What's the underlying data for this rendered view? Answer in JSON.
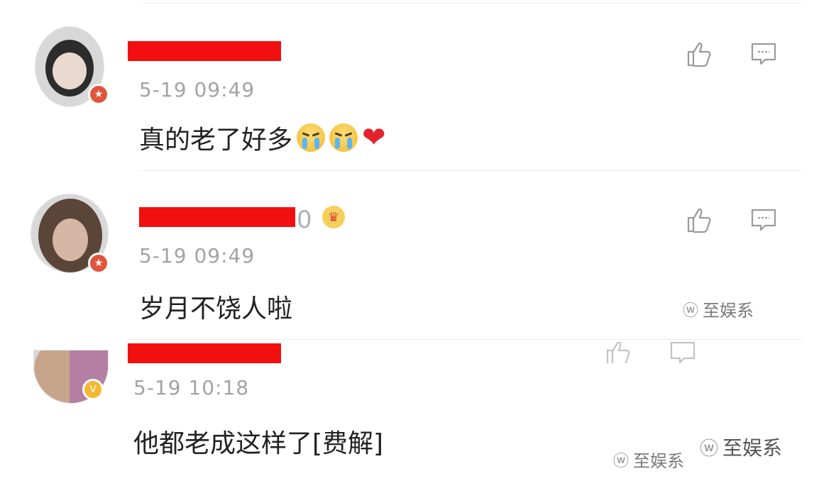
{
  "comments": [
    {
      "time": "5-19 09:49",
      "text": "真的老了好多",
      "emojis": [
        "crying-face",
        "crying-face",
        "red-heart"
      ],
      "badge_icon": "weibo-vip-icon",
      "accent": "#e0553c"
    },
    {
      "time": "5-19 09:49",
      "text": "岁月不饶人啦",
      "name_suffix": "0",
      "badge_icon": "weibo-vip-icon",
      "accent": "#e0553c"
    },
    {
      "time": "5-19 10:18",
      "text": "他都老成这样了[费解]",
      "badge_icon": "v-verified-icon",
      "accent": "#f2b82f"
    }
  ],
  "watermark": {
    "label": "至娱系",
    "icon": "wechat-icon"
  },
  "colors": {
    "redaction": "#f20f0f",
    "timestamp": "#a3a3a3",
    "text": "#222222",
    "icon": "#9a9a9a"
  }
}
